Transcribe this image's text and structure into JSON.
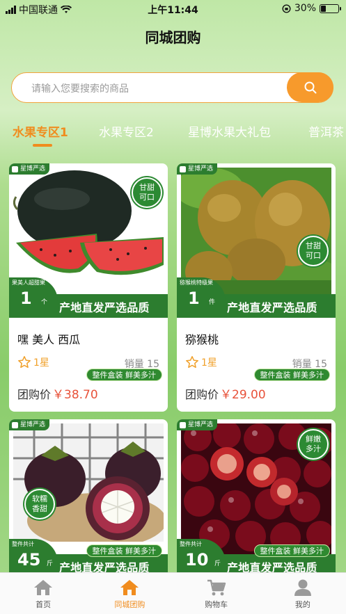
{
  "status_bar": {
    "carrier": "中国联通",
    "time": "上午11:44",
    "battery": "30%",
    "battery_level": 0.3
  },
  "header": {
    "title": "同城团购"
  },
  "search": {
    "placeholder": "请输入您要搜索的商品",
    "icon": "search-icon"
  },
  "tabs": [
    {
      "label": "水果专区1",
      "active": true
    },
    {
      "label": "水果专区2",
      "active": false
    },
    {
      "label": "星博水果大礼包",
      "active": false
    },
    {
      "label": "普洱茶",
      "active": false
    }
  ],
  "products": [
    {
      "brand_badge": "星博严选",
      "sticker": [
        "甘甜",
        "可口"
      ],
      "pill": "整件盒装  鲜美多汁",
      "qty_caption": "果美人超甜果",
      "qty_num": "1",
      "qty_unit": "个",
      "slogan": "产地直发严选品质",
      "name": "嘿 美人 西瓜",
      "rating": "1星",
      "sales": "销量 15",
      "price_label": "团购价",
      "price": "￥38.70"
    },
    {
      "brand_badge": "星博严选",
      "sticker": [
        "甘甜",
        "可口"
      ],
      "pill": "整件盒装  鲜美多汁",
      "qty_caption": "猕猴桃特级果",
      "qty_num": "1",
      "qty_unit": "件",
      "slogan": "产地直发严选品质",
      "name": "猕猴桃",
      "rating": "1星",
      "sales": "销量 15",
      "price_label": "团购价",
      "price": "￥29.00"
    },
    {
      "brand_badge": "星博严选",
      "sticker": [
        "软糯",
        "香甜"
      ],
      "pill": "整件盒装  鲜美多汁",
      "qty_caption": "整件共计",
      "qty_num": "45",
      "qty_unit": "斤",
      "slogan": "产地直发严选品质"
    },
    {
      "brand_badge": "星博严选",
      "sticker": [
        "鲜嫩",
        "多汁"
      ],
      "pill": "整件盒装  鲜美多汁",
      "qty_caption": "整件共计",
      "qty_num": "10",
      "qty_unit": "斤",
      "slogan": "产地直发严选品质"
    }
  ],
  "tabbar": [
    {
      "label": "首页",
      "icon": "home-icon"
    },
    {
      "label": "同城团购",
      "icon": "store-icon",
      "active": true
    },
    {
      "label": "购物车",
      "icon": "cart-icon"
    },
    {
      "label": "我的",
      "icon": "user-icon"
    }
  ],
  "colors": {
    "accent": "#f08c1e",
    "brand_green": "#2c7d2f",
    "price_red": "#e8523a"
  }
}
